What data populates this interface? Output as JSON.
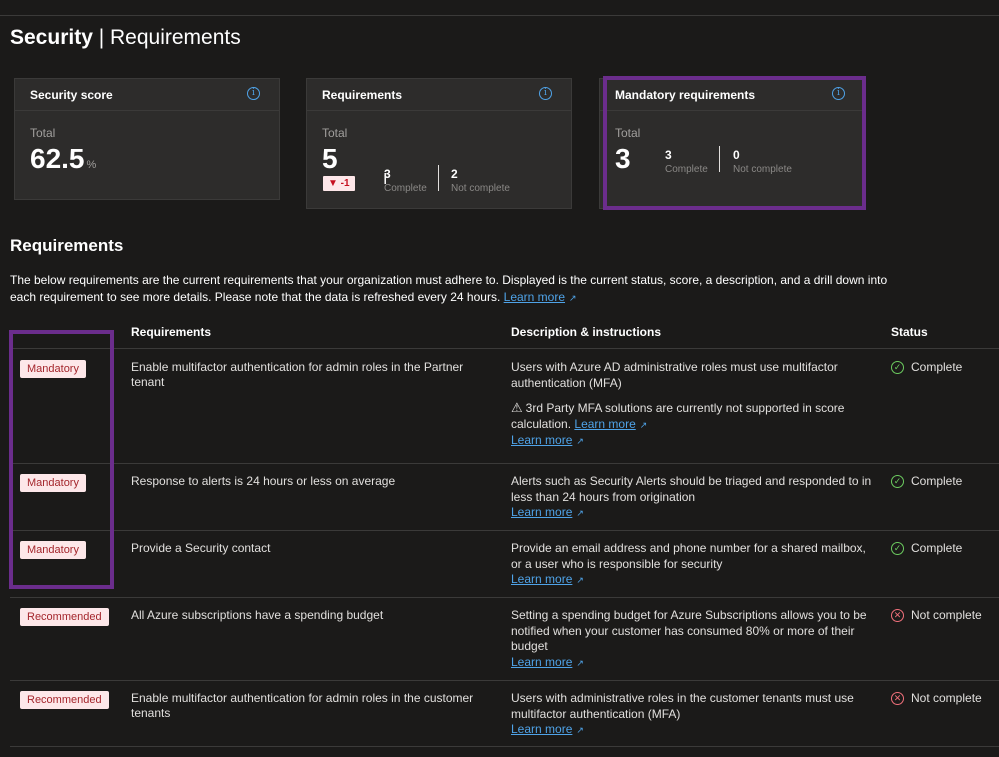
{
  "page": {
    "title_main": "Security",
    "title_sep": " | ",
    "title_sub": "Requirements"
  },
  "cards": {
    "security_score": {
      "title": "Security score",
      "total_label": "Total",
      "value": "62.5",
      "unit": "%"
    },
    "requirements": {
      "title": "Requirements",
      "total_label": "Total",
      "value": "5",
      "delta": "▼ -1",
      "complete_value": "3",
      "complete_label": "Complete",
      "not_complete_value": "2",
      "not_complete_label": "Not complete"
    },
    "mandatory": {
      "title": "Mandatory requirements",
      "total_label": "Total",
      "value": "3",
      "complete_value": "3",
      "complete_label": "Complete",
      "not_complete_value": "0",
      "not_complete_label": "Not complete"
    }
  },
  "section": {
    "title": "Requirements",
    "description": "The below requirements are the current requirements that your organization must adhere to. Displayed is the current status, score, a description, and a drill down into each requirement to see more details. Please note that the data is refreshed every 24 hours.",
    "learn_more": "Learn more"
  },
  "table": {
    "headers": {
      "requirements": "Requirements",
      "description": "Description & instructions",
      "status": "Status"
    },
    "rows": [
      {
        "badge": "Mandatory",
        "requirement": "Enable multifactor authentication for admin roles in the Partner tenant",
        "description": "Users with Azure AD administrative roles must use multifactor authentication (MFA)",
        "warning": "3rd Party MFA solutions are currently not supported in score calculation.",
        "warning_link": "Learn more",
        "learn_more": "Learn more",
        "status": "Complete"
      },
      {
        "badge": "Mandatory",
        "requirement": "Response to alerts is 24 hours or less on average",
        "description": "Alerts such as Security Alerts should be triaged and responded to in less than 24 hours from origination",
        "learn_more": "Learn more",
        "status": "Complete"
      },
      {
        "badge": "Mandatory",
        "requirement": "Provide a Security contact",
        "description": "Provide an email address and phone number for a shared mailbox, or a user who is responsible for security",
        "learn_more": "Learn more",
        "status": "Complete"
      },
      {
        "badge": "Recommended",
        "requirement": "All Azure subscriptions have a spending budget",
        "description": "Setting a spending budget for Azure Subscriptions allows you to be notified when your customer has consumed 80% or more of their budget",
        "learn_more": "Learn more",
        "status": "Not complete"
      },
      {
        "badge": "Recommended",
        "requirement": "Enable multifactor authentication for admin roles in the customer tenants",
        "description": "Users with administrative roles in the customer tenants must use multifactor authentication (MFA)",
        "learn_more": "Learn more",
        "status": "Not complete"
      }
    ]
  },
  "icons": {
    "info": "info-icon",
    "external_link": "external-link-icon",
    "warning": "warning-icon",
    "complete": "check-circle-icon",
    "not_complete": "x-circle-icon",
    "cursor": "text-cursor-icon"
  },
  "colors": {
    "background": "#1b1a19",
    "card": "#2d2c2b",
    "highlight": "#6b2d8c",
    "link": "#4fa3e8",
    "badge_bg": "#fde7e9",
    "badge_text": "#a4262c",
    "complete": "#6ccb5f",
    "not_complete": "#f1707b"
  }
}
